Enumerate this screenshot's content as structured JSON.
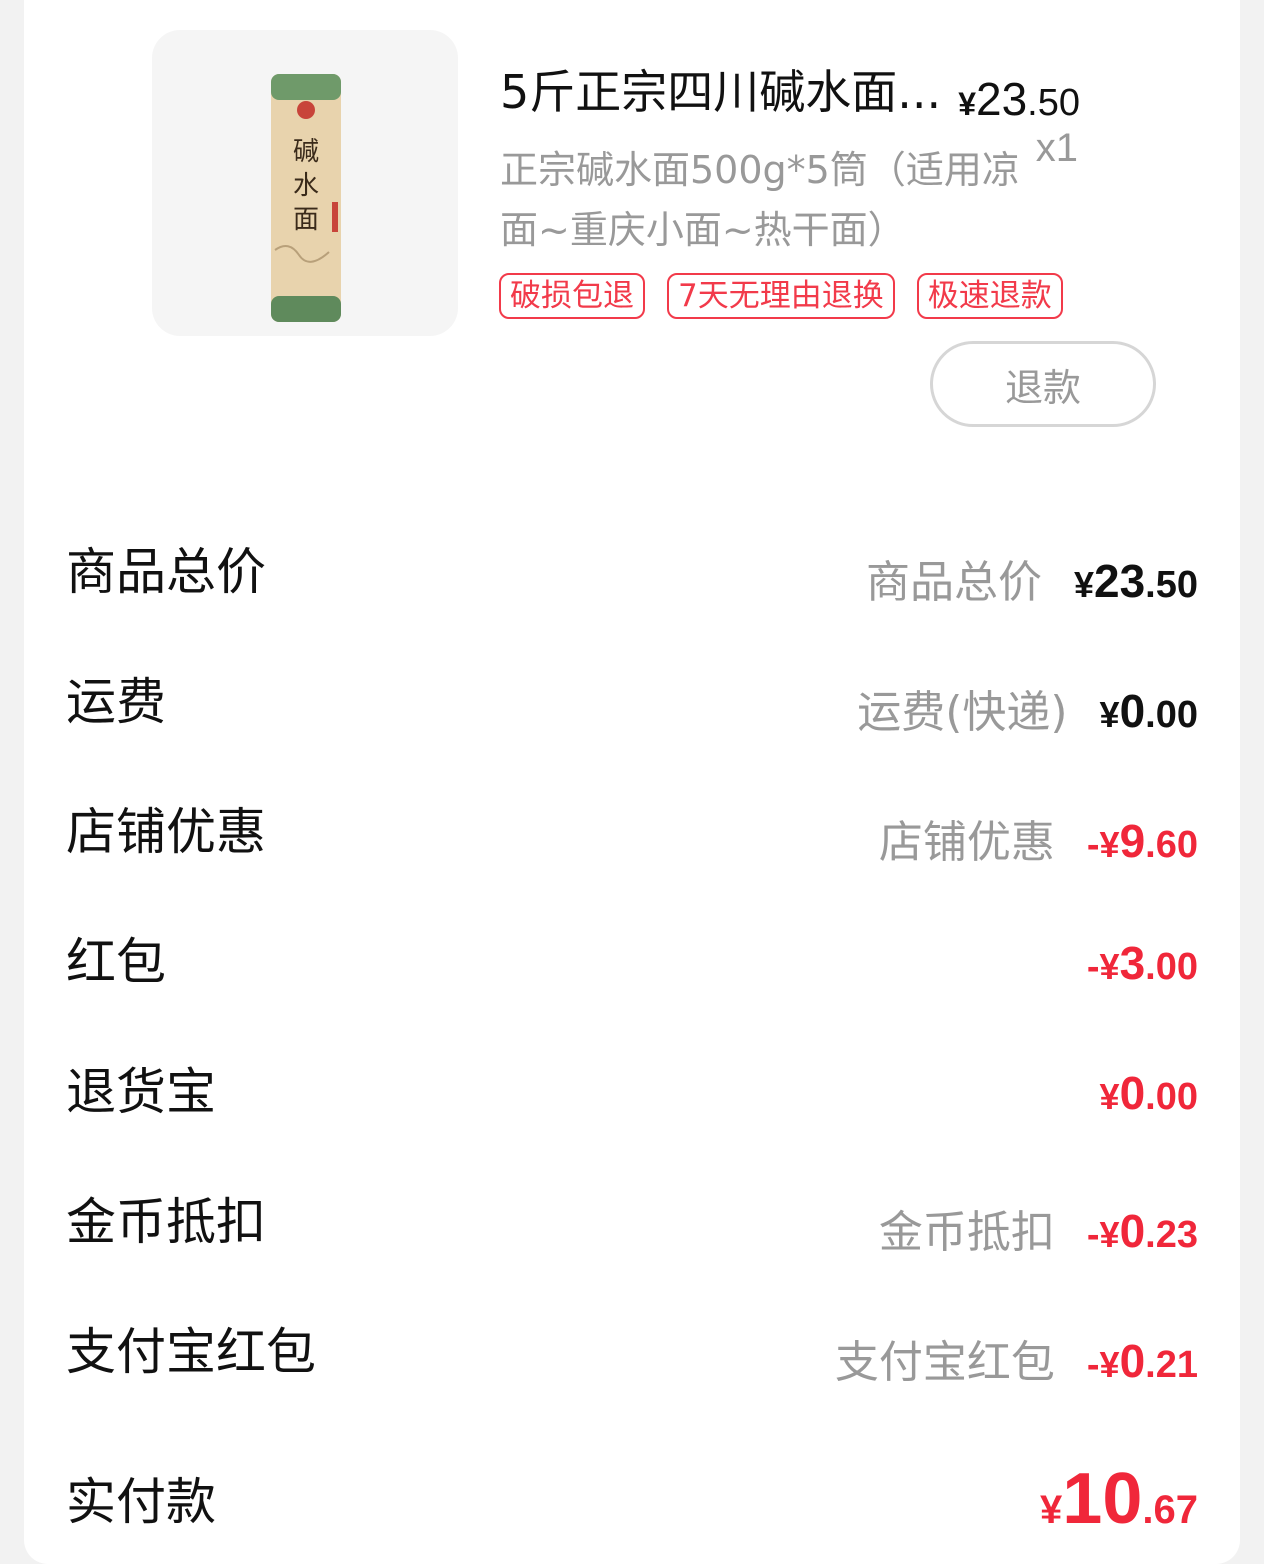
{
  "product": {
    "image_icon": "noodle-canister-image",
    "image_text": "碱水面",
    "title": "5斤正宗四川碱水面...",
    "price": {
      "currency": "¥",
      "integer": "23",
      "decimal": ".50"
    },
    "quantity": "x1",
    "subtitle": "正宗碱水面500g*5筒（适用凉面~重庆小面~热干面）",
    "tags": [
      "破损包退",
      "7天无理由退换",
      "极速退款"
    ],
    "refund_label": "退款"
  },
  "summary": {
    "rows": [
      {
        "label": "商品总价",
        "sub": "商品总价",
        "sign": "",
        "currency": "¥",
        "integer": "23",
        "decimal": ".50",
        "color": "black"
      },
      {
        "label": "运费",
        "sub": "运费(快递)",
        "sign": "",
        "currency": "¥",
        "integer": "0",
        "decimal": ".00",
        "color": "black"
      },
      {
        "label": "店铺优惠",
        "sub": "店铺优惠",
        "sign": "-",
        "currency": "¥",
        "integer": "9",
        "decimal": ".60",
        "color": "red"
      },
      {
        "label": "红包",
        "sub": "",
        "sign": "-",
        "currency": "¥",
        "integer": "3",
        "decimal": ".00",
        "color": "red"
      },
      {
        "label": "退货宝",
        "sub": "",
        "sign": "",
        "currency": "¥",
        "integer": "0",
        "decimal": ".00",
        "color": "red"
      },
      {
        "label": "金币抵扣",
        "sub": "金币抵扣",
        "sign": "-",
        "currency": "¥",
        "integer": "0",
        "decimal": ".23",
        "color": "red"
      },
      {
        "label": "支付宝红包",
        "sub": "支付宝红包",
        "sign": "-",
        "currency": "¥",
        "integer": "0",
        "decimal": ".21",
        "color": "red"
      }
    ],
    "total": {
      "label": "实付款",
      "currency": "¥",
      "integer": "10",
      "decimal": ".67"
    }
  },
  "colors": {
    "accent_red": "#f0273a",
    "muted_gray": "#999999",
    "tag_red": "#f23a4a"
  }
}
